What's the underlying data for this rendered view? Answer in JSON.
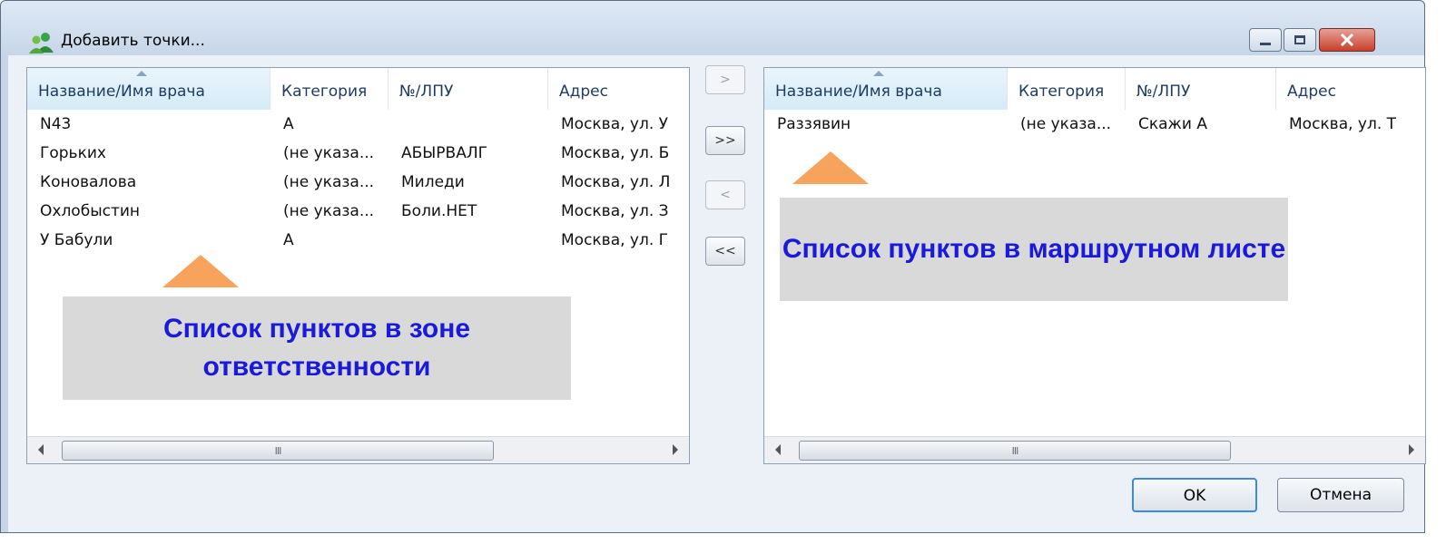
{
  "window": {
    "title": "Добавить точки...",
    "icon": "users-icon"
  },
  "left_list": {
    "columns": [
      "Название/Имя врача",
      "Категория",
      "№/ЛПУ",
      "Адрес"
    ],
    "rows": [
      [
        "N43",
        "A",
        "",
        "Москва, ул. У"
      ],
      [
        "Горьких",
        "(не указа...",
        "АБЫРВАЛГ",
        "Москва, ул. Б"
      ],
      [
        "Коновалова",
        "(не указа...",
        "Миледи",
        "Москва, ул. Л"
      ],
      [
        "Охлобыстин",
        "(не указа...",
        "Боли.НЕТ",
        "Москва, ул. З"
      ],
      [
        "У Бабули",
        "A",
        "",
        "Москва, ул. Г"
      ]
    ]
  },
  "right_list": {
    "columns": [
      "Название/Имя врача",
      "Категория",
      "№/ЛПУ",
      "Адрес"
    ],
    "rows": [
      [
        "Раззявин",
        "(не указа...",
        "Скажи А",
        "Москва, ул. Т"
      ]
    ]
  },
  "move_buttons": {
    "add_one": ">",
    "add_all": ">>",
    "remove_one": "<",
    "remove_all": "<<"
  },
  "scrollbar_grip": "III",
  "callouts": {
    "left": "Список пунктов в зоне ответственности",
    "right": "Список пунктов в маршрутном листе",
    "background": "#d9d9d9",
    "text_color": "#1a1adb",
    "arrow_color": "#f7a35c"
  },
  "buttons": {
    "ok": "OK",
    "cancel": "Отмена"
  }
}
